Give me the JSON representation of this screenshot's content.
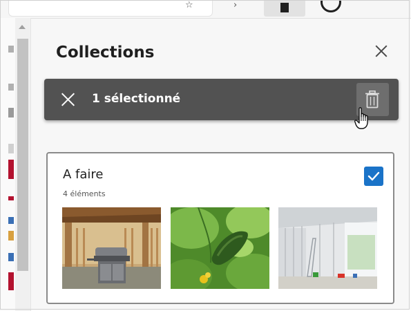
{
  "collections": {
    "title": "Collections",
    "selection_text": "1 sélectionné"
  },
  "card": {
    "title": "A faire",
    "count_text": "4 éléments",
    "checked": true,
    "thumbnails": [
      "gazebo-grill-image",
      "cucumber-plant-image",
      "empty-room-image"
    ]
  },
  "colors": {
    "selection_bar": "#525252",
    "checkbox": "#1a73c8",
    "pane_background": "#f7f7f7"
  }
}
